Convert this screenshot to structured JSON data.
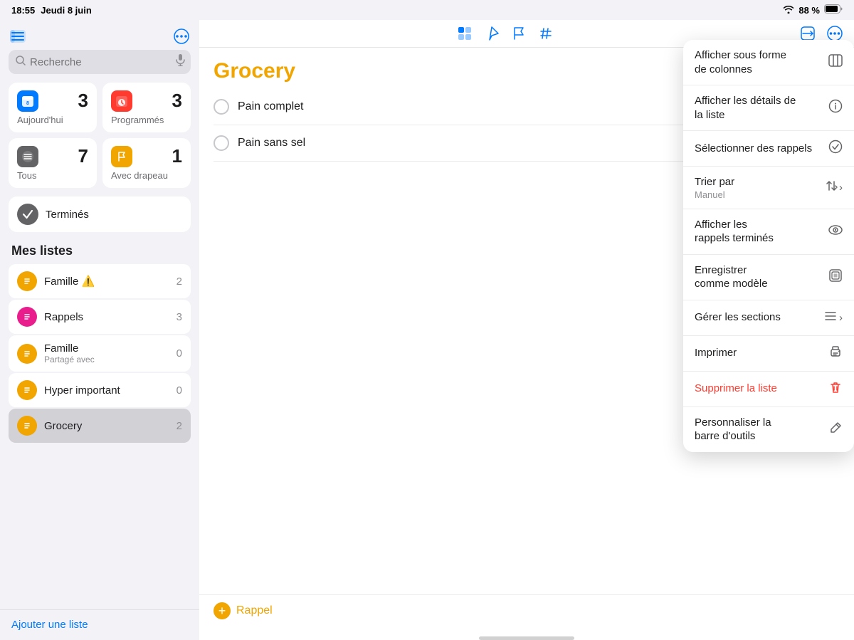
{
  "statusBar": {
    "time": "18:55",
    "date": "Jeudi 8 juin",
    "wifi": "88 %",
    "battery": "🔋"
  },
  "sidebar": {
    "sidebarToggleIcon": "sidebar-icon",
    "moreIcon": "ellipsis-icon",
    "search": {
      "placeholder": "Recherche",
      "micIcon": "mic-icon"
    },
    "smartLists": [
      {
        "id": "today",
        "label": "Aujourd'hui",
        "count": "3",
        "color": "#007aff",
        "icon": "📅"
      },
      {
        "id": "scheduled",
        "label": "Programmés",
        "count": "3",
        "color": "#ff3b30",
        "icon": "📅"
      },
      {
        "id": "all",
        "label": "Tous",
        "count": "7",
        "color": "#1c1c1e",
        "icon": "☰"
      },
      {
        "id": "flagged",
        "label": "Avec drapeau",
        "count": "1",
        "color": "#f0a500",
        "icon": "🚩"
      }
    ],
    "terminesLabel": "Terminés",
    "sectionHeader": "Mes listes",
    "lists": [
      {
        "id": "famille-warn",
        "name": "Famille ⚠️",
        "count": "2",
        "color": "#f0a500",
        "sub": ""
      },
      {
        "id": "rappels",
        "name": "Rappels",
        "count": "3",
        "color": "#e91e8c",
        "sub": ""
      },
      {
        "id": "famille-shared",
        "name": "Famille",
        "count": "0",
        "color": "#f0a500",
        "sub": "Partagé avec"
      },
      {
        "id": "hyper-important",
        "name": "Hyper important",
        "count": "0",
        "color": "#f0a500",
        "sub": ""
      },
      {
        "id": "grocery",
        "name": "Grocery",
        "count": "2",
        "color": "#f0a500",
        "sub": "",
        "selected": true
      }
    ],
    "addListLabel": "Ajouter une liste"
  },
  "main": {
    "title": "Grocery",
    "toolbarIcons": {
      "grid": "grid-icon",
      "location": "location-icon",
      "flag": "flag-icon",
      "hashtag": "hashtag-icon",
      "share": "share-icon",
      "more": "more-icon"
    },
    "tasks": [
      {
        "id": "t1",
        "text": "Pain complet",
        "done": false
      },
      {
        "id": "t2",
        "text": "Pain sans sel",
        "done": false
      }
    ],
    "addReminderLabel": "Rappel"
  },
  "dropdown": {
    "items": [
      {
        "id": "columns",
        "label": "Afficher sous forme\nde colonnes",
        "icon": "⊞",
        "sub": ""
      },
      {
        "id": "details",
        "label": "Afficher les détails de\nla liste",
        "icon": "ℹ",
        "sub": ""
      },
      {
        "id": "select",
        "label": "Sélectionner des rappels",
        "icon": "✓",
        "sub": ""
      },
      {
        "id": "sort",
        "label": "Trier par",
        "sub": "Manuel",
        "icon": "⇅›"
      },
      {
        "id": "show-done",
        "label": "Afficher les\nrappels terminés",
        "icon": "👁",
        "sub": ""
      },
      {
        "id": "save-model",
        "label": "Enregistrer\ncomme modèle",
        "icon": "⊡",
        "sub": ""
      },
      {
        "id": "sections",
        "label": "Gérer les sections",
        "icon": "≡›",
        "sub": ""
      },
      {
        "id": "print",
        "label": "Imprimer",
        "icon": "🖨",
        "sub": ""
      },
      {
        "id": "delete",
        "label": "Supprimer la liste",
        "icon": "🗑",
        "sub": "",
        "red": true
      },
      {
        "id": "customize",
        "label": "Personnaliser la\nbarre d'outils",
        "icon": "🔧",
        "sub": ""
      }
    ]
  }
}
